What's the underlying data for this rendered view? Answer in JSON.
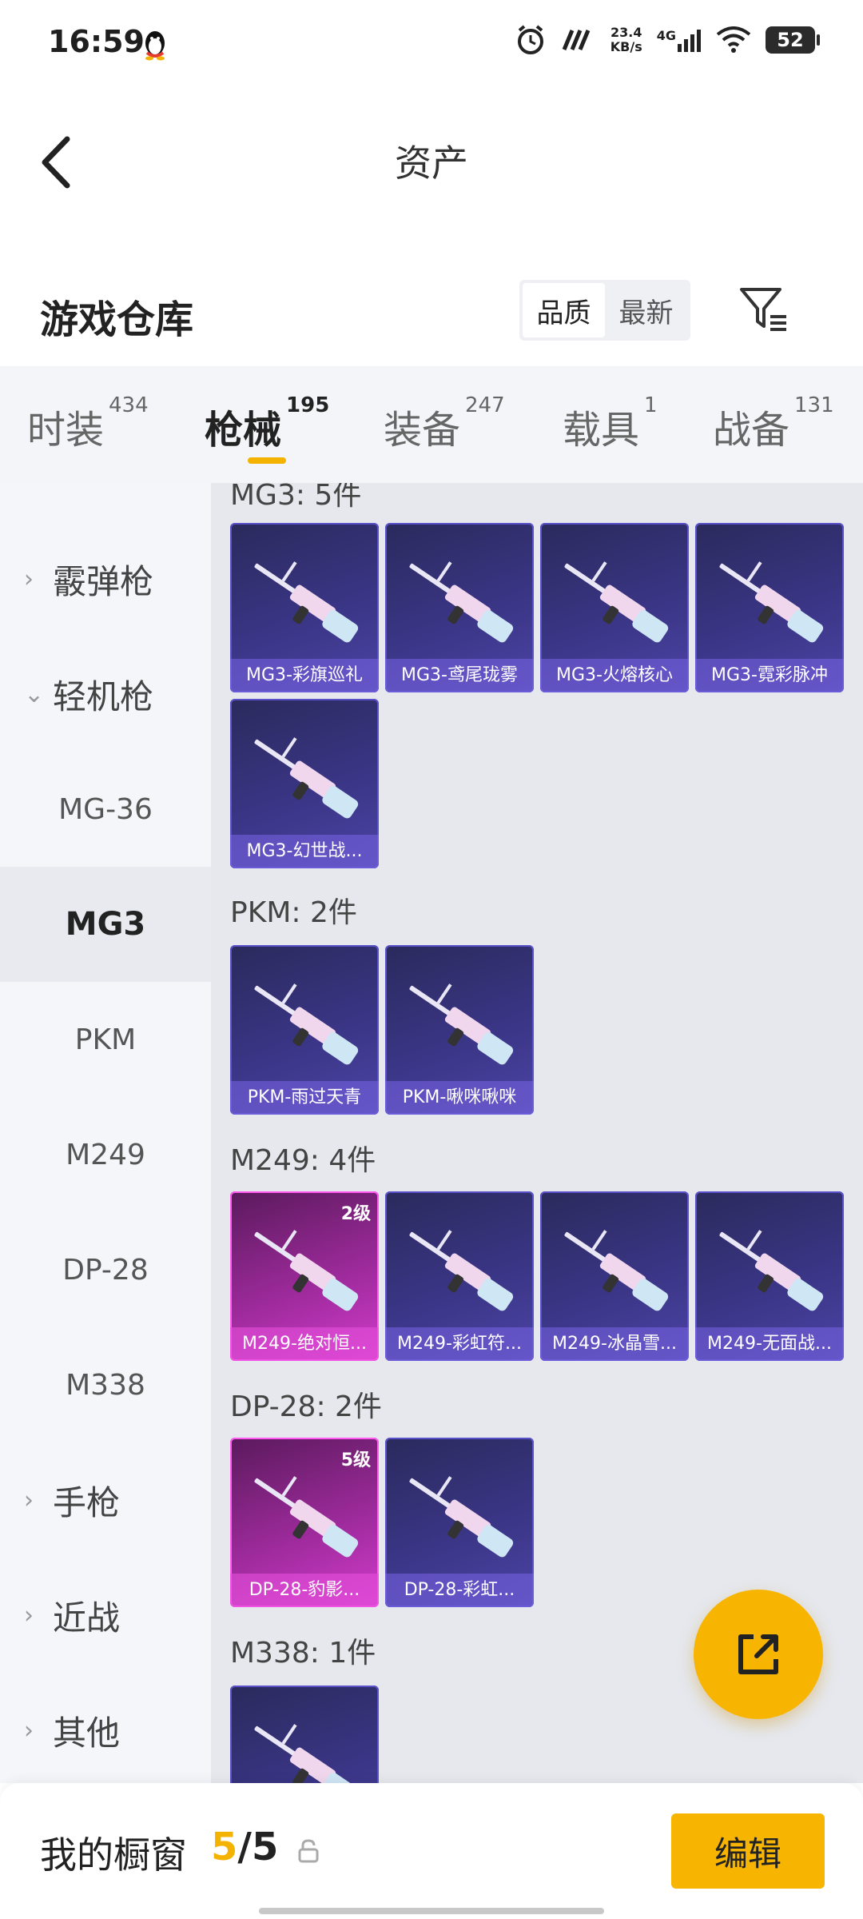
{
  "status_bar": {
    "time": "16:59",
    "net_speed_value": "23.4",
    "net_speed_unit": "KB/s",
    "signal_label": "4G",
    "battery": "52"
  },
  "header": {
    "title": "资产"
  },
  "warehouse": {
    "title": "游戏仓库",
    "sort_options": [
      "品质",
      "最新"
    ],
    "sort_selected": "品质"
  },
  "tabs": [
    {
      "label": "时装",
      "count": "434"
    },
    {
      "label": "枪械",
      "count": "195",
      "active": true
    },
    {
      "label": "装备",
      "count": "247"
    },
    {
      "label": "载具",
      "count": "1"
    },
    {
      "label": "战备",
      "count": "131"
    }
  ],
  "sidebar": [
    {
      "label": "霰弹枪",
      "type": "category",
      "expanded": false
    },
    {
      "label": "轻机枪",
      "type": "category",
      "expanded": true
    },
    {
      "label": "MG-36",
      "type": "sub"
    },
    {
      "label": "MG3",
      "type": "sub",
      "active": true
    },
    {
      "label": "PKM",
      "type": "sub"
    },
    {
      "label": "M249",
      "type": "sub"
    },
    {
      "label": "DP-28",
      "type": "sub"
    },
    {
      "label": "M338",
      "type": "sub"
    },
    {
      "label": "手枪",
      "type": "category",
      "expanded": false
    },
    {
      "label": "近战",
      "type": "category",
      "expanded": false
    },
    {
      "label": "其他",
      "type": "category",
      "expanded": false
    }
  ],
  "groups": [
    {
      "label": "MG3: 5件",
      "items": [
        {
          "name": "MG3-彩旗巡礼",
          "rarity": "purple"
        },
        {
          "name": "MG3-鸢尾珑雾",
          "rarity": "purple"
        },
        {
          "name": "MG3-火熔核心",
          "rarity": "purple"
        },
        {
          "name": "MG3-霓彩脉冲",
          "rarity": "purple"
        },
        {
          "name": "MG3-幻世战...",
          "rarity": "purple"
        }
      ]
    },
    {
      "label": "PKM: 2件",
      "items": [
        {
          "name": "PKM-雨过天青",
          "rarity": "purple"
        },
        {
          "name": "PKM-啾咪啾咪",
          "rarity": "purple"
        }
      ]
    },
    {
      "label": "M249: 4件",
      "items": [
        {
          "name": "M249-绝对恒...",
          "rarity": "pink",
          "level": "2级"
        },
        {
          "name": "M249-彩虹符...",
          "rarity": "purple"
        },
        {
          "name": "M249-冰晶雪...",
          "rarity": "purple"
        },
        {
          "name": "M249-无面战...",
          "rarity": "purple"
        }
      ]
    },
    {
      "label": "DP-28: 2件",
      "items": [
        {
          "name": "DP-28-豹影...",
          "rarity": "pink",
          "level": "5级"
        },
        {
          "name": "DP-28-彩虹...",
          "rarity": "purple"
        }
      ]
    },
    {
      "label": "M338: 1件",
      "items": [
        {
          "name": "",
          "rarity": "purple"
        }
      ]
    }
  ],
  "bottom_bar": {
    "title": "我的橱窗",
    "current": "5",
    "separator": "/",
    "total": "5",
    "edit_label": "编辑"
  },
  "colors": {
    "accent": "#f7b400",
    "purple_card": "#3a3585",
    "pink_card": "#9c2a9a"
  }
}
